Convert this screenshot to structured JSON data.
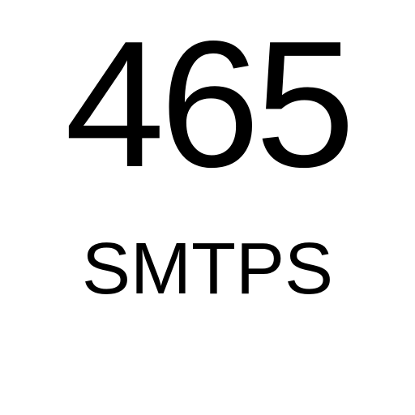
{
  "icon": {
    "port": "465",
    "protocol": "SMTPS",
    "text_color": "#000000",
    "background_color": "#ffffff"
  }
}
